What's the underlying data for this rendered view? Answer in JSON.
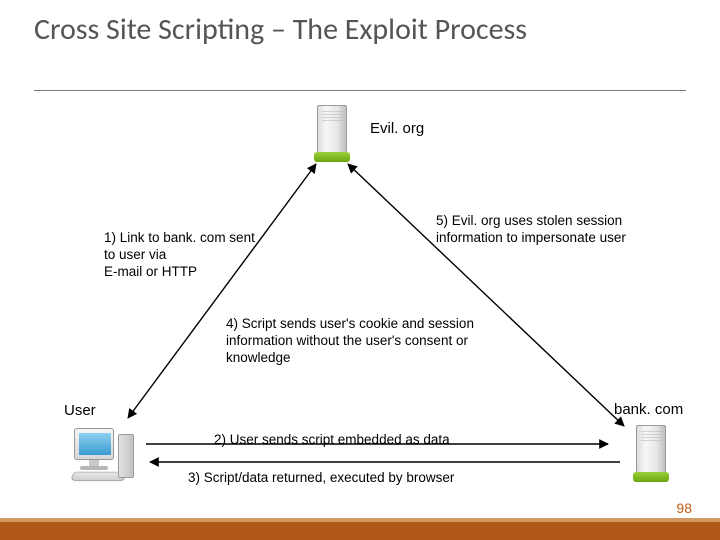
{
  "title": "Cross Site Scripting – The Exploit Process",
  "nodes": {
    "evil_label": "Evil. org",
    "user_label": "User",
    "bank_label": "bank. com"
  },
  "steps": {
    "s1": "1) Link to bank. com sent to user via\nE-mail or HTTP",
    "s2": "2) User sends script embedded as data",
    "s3": "3) Script/data returned, executed by browser",
    "s4": "4) Script sends user's cookie and session information without the user's consent or knowledge",
    "s5": "5) Evil. org uses stolen session information to impersonate user"
  },
  "page_number": "98"
}
